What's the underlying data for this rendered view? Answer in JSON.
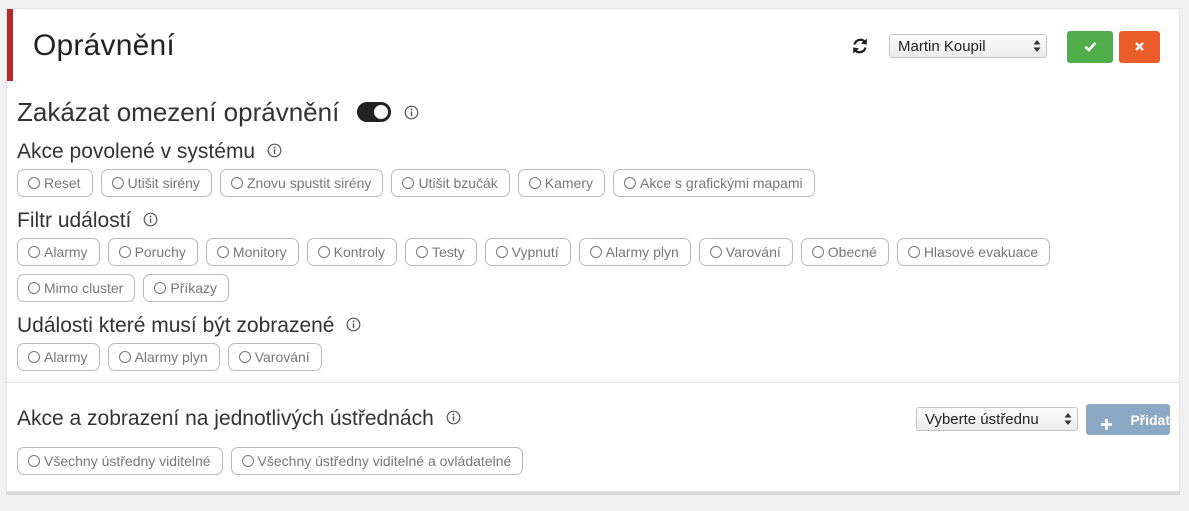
{
  "header": {
    "title": "Oprávnění",
    "refresh_icon": "refresh-icon",
    "user_select": {
      "value": "Martin Koupil"
    },
    "confirm_icon": "check-icon",
    "cancel_icon": "close-icon",
    "colors": {
      "accent": "#b32b26",
      "confirm": "#4fae4a",
      "cancel": "#ea5d2b",
      "add": "#8ba9c4"
    }
  },
  "disable_restrictions": {
    "label": "Zakázat omezení oprávnění",
    "toggle_on": true
  },
  "system_actions": {
    "label": "Akce povolené v systému",
    "options": [
      "Reset",
      "Utišit sirény",
      "Znovu spustit sirény",
      "Utišit bzučák",
      "Kamery",
      "Akce s grafickými mapami"
    ]
  },
  "event_filter": {
    "label": "Filtr událostí",
    "options_row1": [
      "Alarmy",
      "Poruchy",
      "Monitory",
      "Kontroly",
      "Testy",
      "Vypnutí",
      "Alarmy plyn",
      "Varování",
      "Obecné",
      "Hlasové evakuace"
    ],
    "options_row2": [
      "Mimo cluster",
      "Příkazy"
    ]
  },
  "required_events": {
    "label": "Události které musí být zobrazené",
    "options": [
      "Alarmy",
      "Alarmy plyn",
      "Varování"
    ]
  },
  "per_unit": {
    "label": "Akce a zobrazení na jednotlivých ústřednách",
    "select": {
      "value": "Vyberte ústřednu"
    },
    "add_button": {
      "label": "Přidat",
      "icon": "plus-icon"
    },
    "options": [
      "Všechny ústředny viditelné",
      "Všechny ústředny viditelné a ovládatelné"
    ]
  }
}
